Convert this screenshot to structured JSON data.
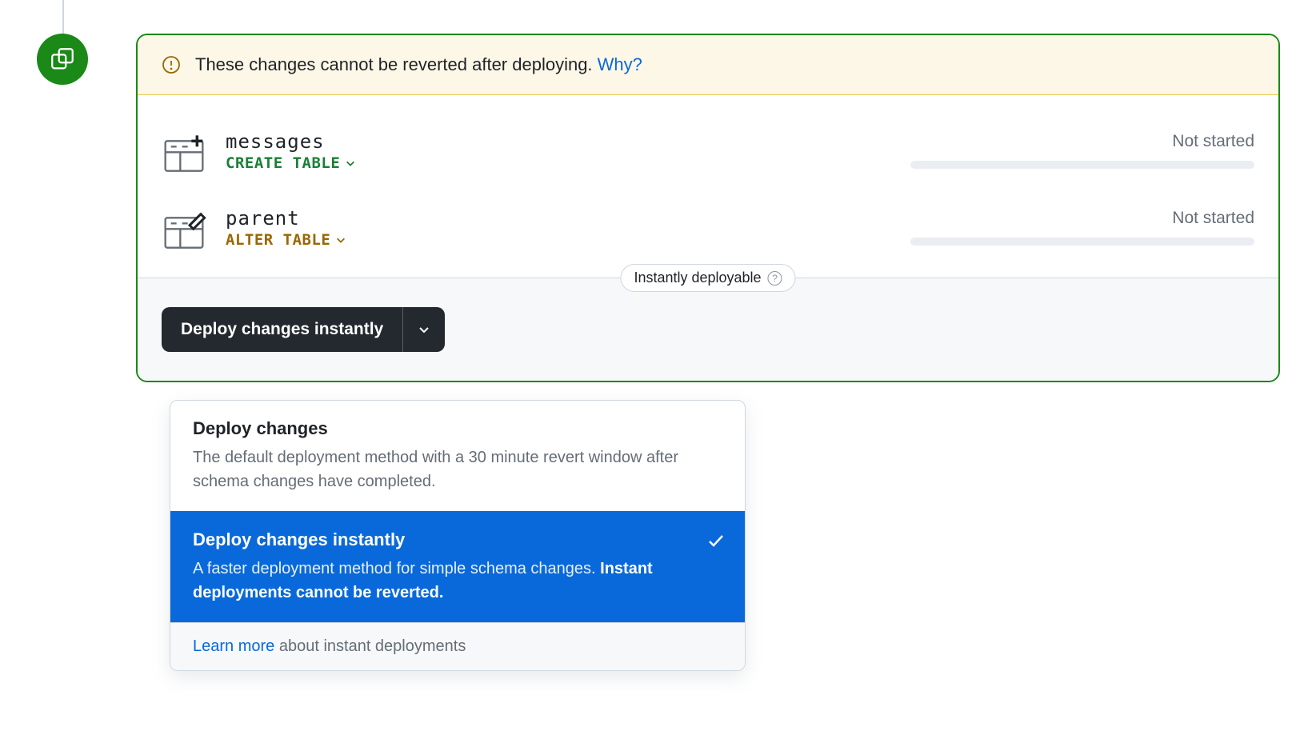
{
  "banner": {
    "text": "These changes cannot be reverted after deploying. ",
    "link_label": "Why?"
  },
  "items": [
    {
      "name": "messages",
      "action": "CREATE TABLE",
      "action_kind": "create",
      "status": "Not started"
    },
    {
      "name": "parent",
      "action": "ALTER TABLE",
      "action_kind": "alter",
      "status": "Not started"
    }
  ],
  "footer": {
    "pill_label": "Instantly deployable",
    "button_label": "Deploy changes instantly"
  },
  "dropdown": {
    "options": [
      {
        "title": "Deploy changes",
        "desc": "The default deployment method with a 30 minute revert window after schema changes have completed.",
        "selected": false
      },
      {
        "title": "Deploy changes instantly",
        "desc_prefix": "A faster deployment method for simple schema changes. ",
        "desc_strong": "Instant deployments cannot be reverted.",
        "selected": true
      }
    ],
    "learn_more_label": "Learn more",
    "learn_more_suffix": " about instant deployments"
  }
}
